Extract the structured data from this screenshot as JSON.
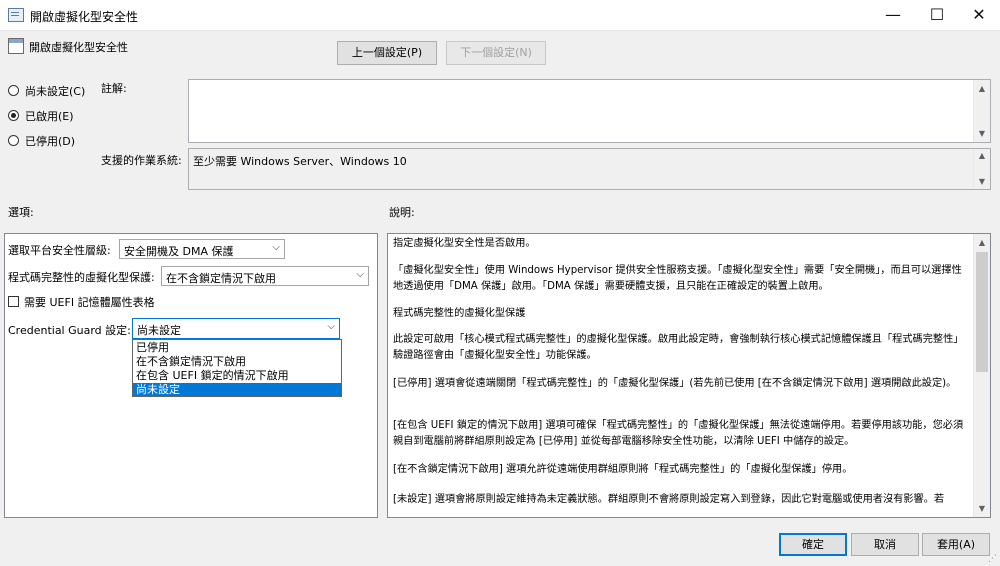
{
  "window": {
    "title": "開啟虛擬化型安全性",
    "controls": {
      "minimize": "—",
      "maximize": "☐",
      "close": "✕"
    }
  },
  "header": {
    "policy_title": "開啟虛擬化型安全性",
    "prev_button": "上一個設定(P)",
    "next_button": "下一個設定(N)"
  },
  "state": {
    "options": [
      "尚未設定(C)",
      "已啟用(E)",
      "已停用(D)"
    ],
    "selected": "已啟用(E)"
  },
  "comment": {
    "label": "註解:",
    "value": ""
  },
  "supported": {
    "label": "支援的作業系統:",
    "value": "至少需要 Windows Server、Windows 10"
  },
  "options_section": {
    "label": "選項:",
    "platform_label": "選取平台安全性層級:",
    "platform_value": "安全開機及 DMA 保護",
    "hvci_label": "程式碼完整性的虛擬化型保護:",
    "hvci_value": "在不含鎖定情況下啟用",
    "uefi_checkbox_label": "需要 UEFI 記憶體屬性表格",
    "uefi_checked": false,
    "cg_label": "Credential Guard 設定:",
    "cg_value": "尚未設定",
    "cg_options": [
      "已停用",
      "在不含鎖定情況下啟用",
      "在包含 UEFI 鎖定的情況下啟用",
      "尚未設定"
    ],
    "cg_selected": "尚未設定"
  },
  "help_section": {
    "label": "說明:",
    "paragraphs": [
      "指定虛擬化型安全性是否啟用。",
      "「虛擬化型安全性」使用 Windows Hypervisor 提供安全性服務支援。「虛擬化型安全性」需要「安全開機」，而且可以選擇性地透過使用「DMA 保護」啟用。「DMA 保護」需要硬體支援，且只能在正確設定的裝置上啟用。",
      "程式碼完整性的虛擬化型保護",
      "此設定可啟用「核心模式程式碼完整性」的虛擬化型保護。啟用此設定時，會強制執行核心模式記憶體保護且「程式碼完整性」驗證路徑會由「虛擬化型安全性」功能保護。",
      "[已停用] 選項會從遠端關閉「程式碼完整性」的「虛擬化型保護」(若先前已使用 [在不含鎖定情況下啟用] 選項開啟此設定)。",
      "[在包含 UEFI 鎖定的情況下啟用] 選項可確保「程式碼完整性」的「虛擬化型保護」無法從遠端停用。若要停用該功能，您必須親自到電腦前將群組原則設定為 [已停用] 並從每部電腦移除安全性功能，以清除 UEFI 中儲存的設定。",
      "[在不含鎖定情況下啟用] 選項允許從遠端使用群組原則將「程式碼完整性」的「虛擬化型保護」停用。",
      "[未設定] 選項會將原則設定維持為未定義狀態。群組原則不會將原則設定寫入到登錄，因此它對電腦或使用者沒有影響。若"
    ]
  },
  "footer": {
    "ok": "確定",
    "cancel": "取消",
    "apply": "套用(A)"
  },
  "colors": {
    "accent": "#0078d7",
    "window_bg": "#f0f0f0"
  }
}
